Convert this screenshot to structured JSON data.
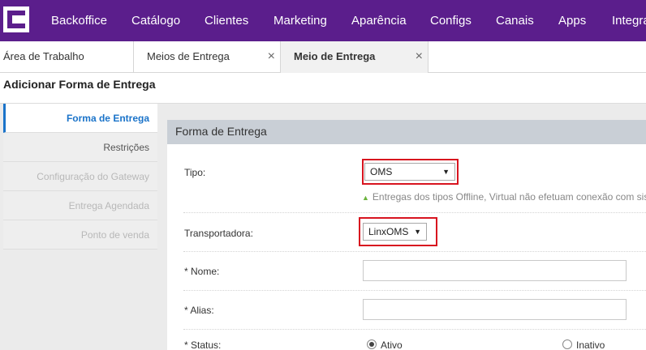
{
  "nav": {
    "items": [
      "Backoffice",
      "Catálogo",
      "Clientes",
      "Marketing",
      "Aparência",
      "Configs",
      "Canais",
      "Apps",
      "Integra"
    ]
  },
  "tabs": [
    {
      "label": "Área de Trabalho"
    },
    {
      "label": "Meios de Entrega",
      "close": "×"
    },
    {
      "label": "Meio de Entrega",
      "close": "×"
    }
  ],
  "page": {
    "title": "Adicionar Forma de Entrega"
  },
  "sidebar": {
    "items": [
      {
        "label": "Forma de Entrega"
      },
      {
        "label": "Restrições"
      },
      {
        "label": "Configuração do Gateway"
      },
      {
        "label": "Entrega Agendada"
      },
      {
        "label": "Ponto de venda"
      }
    ]
  },
  "panel": {
    "title": "Forma de Entrega",
    "tipo": {
      "label": "Tipo:",
      "value": "OMS",
      "hint": "Entregas dos tipos Offline, Virtual não efetuam conexão com sis"
    },
    "transportadora": {
      "label": "Transportadora:",
      "value": "LinxOMS"
    },
    "nome": {
      "label": "* Nome:",
      "value": ""
    },
    "alias": {
      "label": "* Alias:",
      "value": ""
    },
    "status": {
      "label": "* Status:",
      "option_active": "Ativo",
      "option_inactive": "Inativo"
    }
  },
  "colors": {
    "nav_bg": "#5b1e8c",
    "accent": "#1a73c9",
    "highlight": "#d8141f",
    "hint_icon": "#6bb33c"
  }
}
